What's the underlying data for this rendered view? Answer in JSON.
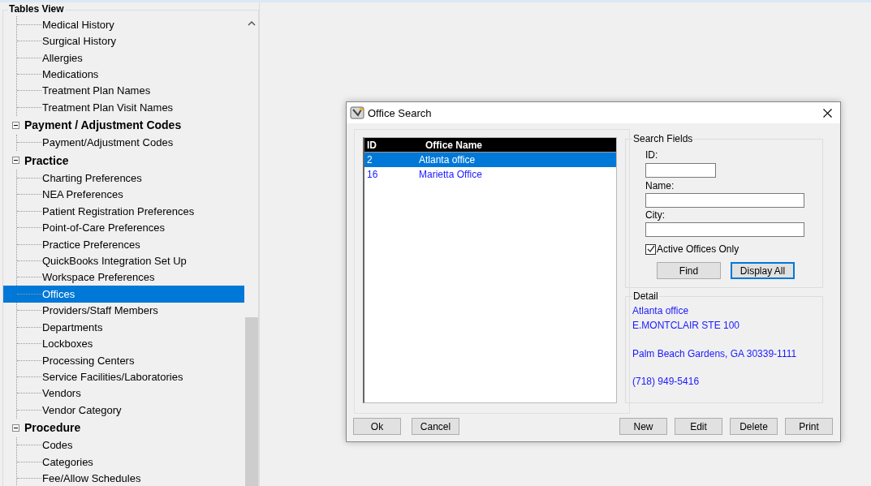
{
  "panel": {
    "title": "Tables View"
  },
  "tree": [
    {
      "children": [
        {
          "label": "Medical History",
          "selected": false
        },
        {
          "label": "Surgical History",
          "selected": false
        },
        {
          "label": "Allergies",
          "selected": false
        },
        {
          "label": "Medications",
          "selected": false
        },
        {
          "label": "Treatment Plan Names",
          "selected": false
        },
        {
          "label": "Treatment Plan Visit Names",
          "selected": false
        }
      ]
    },
    {
      "label": "Payment / Adjustment Codes",
      "expanded": true,
      "children": [
        {
          "label": "Payment/Adjustment Codes",
          "selected": false
        }
      ]
    },
    {
      "label": "Practice",
      "expanded": true,
      "children": [
        {
          "label": "Charting Preferences",
          "selected": false
        },
        {
          "label": "NEA Preferences",
          "selected": false
        },
        {
          "label": "Patient Registration Preferences",
          "selected": false
        },
        {
          "label": "Point-of-Care Preferences",
          "selected": false
        },
        {
          "label": "Practice Preferences",
          "selected": false
        },
        {
          "label": "QuickBooks Integration Set Up",
          "selected": false
        },
        {
          "label": "Workspace Preferences",
          "selected": false
        },
        {
          "label": "Offices",
          "selected": true
        },
        {
          "label": "Providers/Staff Members",
          "selected": false
        },
        {
          "label": "Departments",
          "selected": false
        },
        {
          "label": "Lockboxes",
          "selected": false
        },
        {
          "label": "Processing Centers",
          "selected": false
        },
        {
          "label": "Service Facilities/Laboratories",
          "selected": false
        },
        {
          "label": "Vendors",
          "selected": false
        },
        {
          "label": "Vendor Category",
          "selected": false
        }
      ]
    },
    {
      "label": "Procedure",
      "expanded": true,
      "children": [
        {
          "label": "Codes",
          "selected": false
        },
        {
          "label": "Categories",
          "selected": false
        },
        {
          "label": "Fee/Allow Schedules",
          "selected": false
        }
      ]
    }
  ],
  "dialog": {
    "title": "Office Search",
    "table": {
      "columns": [
        "ID",
        "Office Name"
      ],
      "rows": [
        {
          "id": "2",
          "name": "Atlanta office",
          "selected": true
        },
        {
          "id": "16",
          "name": "Marietta Office",
          "selected": false
        }
      ]
    },
    "search_fields": {
      "title": "Search Fields",
      "id_label": "ID:",
      "name_label": "Name:",
      "city_label": "City:",
      "active_only": {
        "label": "Active Offices Only",
        "checked": true
      },
      "buttons": [
        {
          "label": "Find",
          "focused": false
        },
        {
          "label": "Display All",
          "focused": true
        }
      ]
    },
    "detail": {
      "title": "Detail",
      "name": "Atlanta office",
      "address": "E.MONTCLAIR STE 100",
      "city_line": "Palm Beach Gardens, GA  30339-1111",
      "phone": "(718) 949-5416"
    },
    "left_buttons": [
      "Ok",
      "Cancel"
    ],
    "right_buttons": [
      "New",
      "Edit",
      "Delete",
      "Print"
    ]
  }
}
